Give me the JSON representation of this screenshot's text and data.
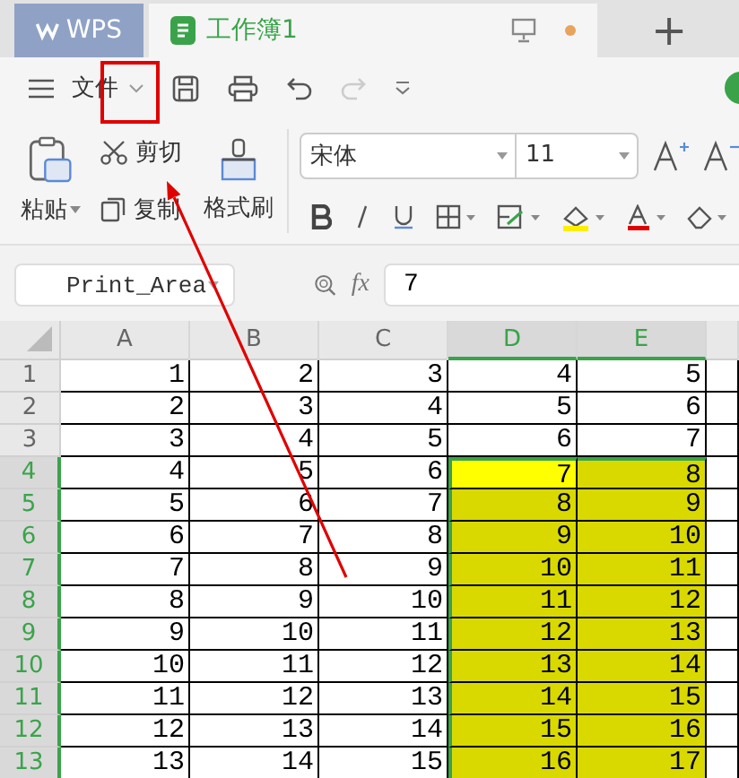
{
  "tabs": [
    {
      "kind": "brand",
      "label": "WPS",
      "selected": false
    },
    {
      "kind": "document",
      "label": "工作簿1",
      "selected": true
    }
  ],
  "new_tab_button": "+",
  "menu": {
    "label": "文件"
  },
  "clipboard": {
    "paste": "粘贴",
    "cut": "剪切",
    "copy": "复制",
    "format_painter": "格式刷"
  },
  "font": {
    "family": "宋体",
    "size": "11"
  },
  "formula_bar": {
    "name_box": "Print_Area",
    "fx": "fx",
    "value": "7"
  },
  "columns": [
    {
      "label": "A",
      "selected": false
    },
    {
      "label": "B",
      "selected": false
    },
    {
      "label": "C",
      "selected": false
    },
    {
      "label": "D",
      "selected": true
    },
    {
      "label": "E",
      "selected": true
    }
  ],
  "rows": [
    {
      "label": "1",
      "selected": false,
      "cells": [
        {
          "value": "1",
          "selected": false,
          "active": false
        },
        {
          "value": "2",
          "selected": false,
          "active": false
        },
        {
          "value": "3",
          "selected": false,
          "active": false
        },
        {
          "value": "4",
          "selected": false,
          "active": false
        },
        {
          "value": "5",
          "selected": false,
          "active": false
        }
      ]
    },
    {
      "label": "2",
      "selected": false,
      "cells": [
        {
          "value": "2",
          "selected": false,
          "active": false
        },
        {
          "value": "3",
          "selected": false,
          "active": false
        },
        {
          "value": "4",
          "selected": false,
          "active": false
        },
        {
          "value": "5",
          "selected": false,
          "active": false
        },
        {
          "value": "6",
          "selected": false,
          "active": false
        }
      ]
    },
    {
      "label": "3",
      "selected": false,
      "cells": [
        {
          "value": "3",
          "selected": false,
          "active": false
        },
        {
          "value": "4",
          "selected": false,
          "active": false
        },
        {
          "value": "5",
          "selected": false,
          "active": false
        },
        {
          "value": "6",
          "selected": false,
          "active": false
        },
        {
          "value": "7",
          "selected": false,
          "active": false
        }
      ]
    },
    {
      "label": "4",
      "selected": true,
      "cells": [
        {
          "value": "4",
          "selected": false,
          "active": false
        },
        {
          "value": "5",
          "selected": false,
          "active": false
        },
        {
          "value": "6",
          "selected": false,
          "active": false
        },
        {
          "value": "7",
          "selected": true,
          "active": true
        },
        {
          "value": "8",
          "selected": true,
          "active": false
        }
      ]
    },
    {
      "label": "5",
      "selected": true,
      "cells": [
        {
          "value": "5",
          "selected": false,
          "active": false
        },
        {
          "value": "6",
          "selected": false,
          "active": false
        },
        {
          "value": "7",
          "selected": false,
          "active": false
        },
        {
          "value": "8",
          "selected": true,
          "active": false
        },
        {
          "value": "9",
          "selected": true,
          "active": false
        }
      ]
    },
    {
      "label": "6",
      "selected": true,
      "cells": [
        {
          "value": "6",
          "selected": false,
          "active": false
        },
        {
          "value": "7",
          "selected": false,
          "active": false
        },
        {
          "value": "8",
          "selected": false,
          "active": false
        },
        {
          "value": "9",
          "selected": true,
          "active": false
        },
        {
          "value": "10",
          "selected": true,
          "active": false
        }
      ]
    },
    {
      "label": "7",
      "selected": true,
      "cells": [
        {
          "value": "7",
          "selected": false,
          "active": false
        },
        {
          "value": "8",
          "selected": false,
          "active": false
        },
        {
          "value": "9",
          "selected": false,
          "active": false
        },
        {
          "value": "10",
          "selected": true,
          "active": false
        },
        {
          "value": "11",
          "selected": true,
          "active": false
        }
      ]
    },
    {
      "label": "8",
      "selected": true,
      "cells": [
        {
          "value": "8",
          "selected": false,
          "active": false
        },
        {
          "value": "9",
          "selected": false,
          "active": false
        },
        {
          "value": "10",
          "selected": false,
          "active": false
        },
        {
          "value": "11",
          "selected": true,
          "active": false
        },
        {
          "value": "12",
          "selected": true,
          "active": false
        }
      ]
    },
    {
      "label": "9",
      "selected": true,
      "cells": [
        {
          "value": "9",
          "selected": false,
          "active": false
        },
        {
          "value": "10",
          "selected": false,
          "active": false
        },
        {
          "value": "11",
          "selected": false,
          "active": false
        },
        {
          "value": "12",
          "selected": true,
          "active": false
        },
        {
          "value": "13",
          "selected": true,
          "active": false
        }
      ]
    },
    {
      "label": "10",
      "selected": true,
      "cells": [
        {
          "value": "10",
          "selected": false,
          "active": false
        },
        {
          "value": "11",
          "selected": false,
          "active": false
        },
        {
          "value": "12",
          "selected": false,
          "active": false
        },
        {
          "value": "13",
          "selected": true,
          "active": false
        },
        {
          "value": "14",
          "selected": true,
          "active": false
        }
      ]
    },
    {
      "label": "11",
      "selected": true,
      "cells": [
        {
          "value": "11",
          "selected": false,
          "active": false
        },
        {
          "value": "12",
          "selected": false,
          "active": false
        },
        {
          "value": "13",
          "selected": false,
          "active": false
        },
        {
          "value": "14",
          "selected": true,
          "active": false
        },
        {
          "value": "15",
          "selected": true,
          "active": false
        }
      ]
    },
    {
      "label": "12",
      "selected": true,
      "cells": [
        {
          "value": "12",
          "selected": false,
          "active": false
        },
        {
          "value": "13",
          "selected": false,
          "active": false
        },
        {
          "value": "14",
          "selected": false,
          "active": false
        },
        {
          "value": "15",
          "selected": true,
          "active": false
        },
        {
          "value": "16",
          "selected": true,
          "active": false
        }
      ]
    },
    {
      "label": "13",
      "selected": true,
      "cells": [
        {
          "value": "13",
          "selected": false,
          "active": false
        },
        {
          "value": "14",
          "selected": false,
          "active": false
        },
        {
          "value": "15",
          "selected": false,
          "active": false
        },
        {
          "value": "16",
          "selected": true,
          "active": false
        },
        {
          "value": "17",
          "selected": true,
          "active": false
        }
      ]
    }
  ]
}
